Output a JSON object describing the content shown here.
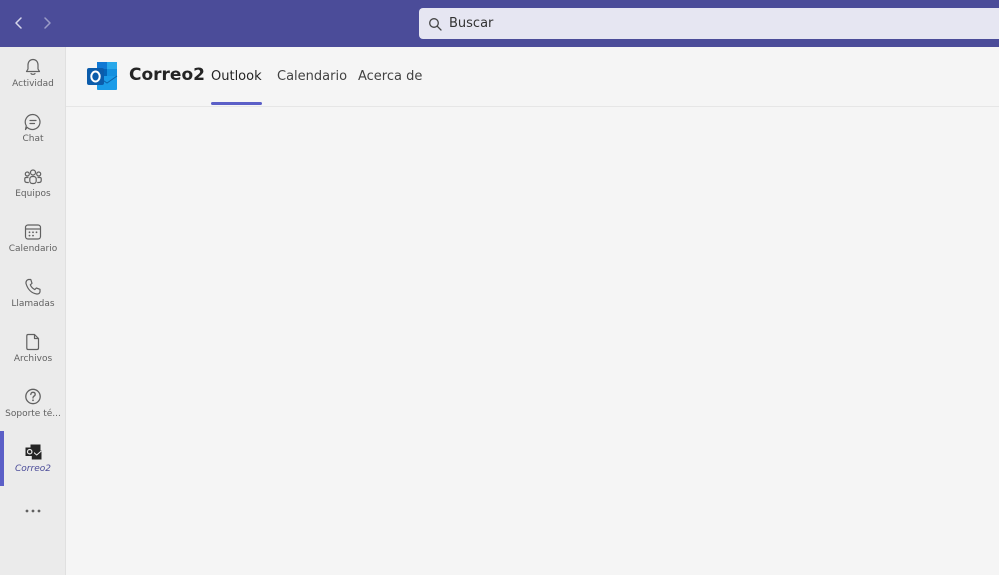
{
  "colors": {
    "topbar": "#4b4c99",
    "accent": "#5b5fc7",
    "rail": "#ebebeb",
    "content_bg": "#f5f5f5"
  },
  "topbar": {
    "back_icon": "chevron-left-icon",
    "forward_icon": "chevron-right-icon",
    "search": {
      "icon": "search-icon",
      "placeholder": "Buscar"
    }
  },
  "rail": {
    "items": [
      {
        "label": "Actividad",
        "icon": "bell-icon"
      },
      {
        "label": "Chat",
        "icon": "chat-icon"
      },
      {
        "label": "Equipos",
        "icon": "teams-icon"
      },
      {
        "label": "Calendario",
        "icon": "calendar-icon"
      },
      {
        "label": "Llamadas",
        "icon": "phone-icon"
      },
      {
        "label": "Archivos",
        "icon": "file-icon"
      },
      {
        "label": "Soporte té...",
        "icon": "help-icon"
      },
      {
        "label": "Correo2",
        "icon": "outlook-app-icon",
        "active": true
      }
    ],
    "more_icon": "more-horizontal-icon"
  },
  "app": {
    "title": "Correo2",
    "logo_icon": "outlook-logo-icon",
    "tabs": [
      {
        "label": "Outlook",
        "active": true
      },
      {
        "label": "Calendario",
        "active": false
      },
      {
        "label": "Acerca de",
        "active": false
      }
    ]
  }
}
